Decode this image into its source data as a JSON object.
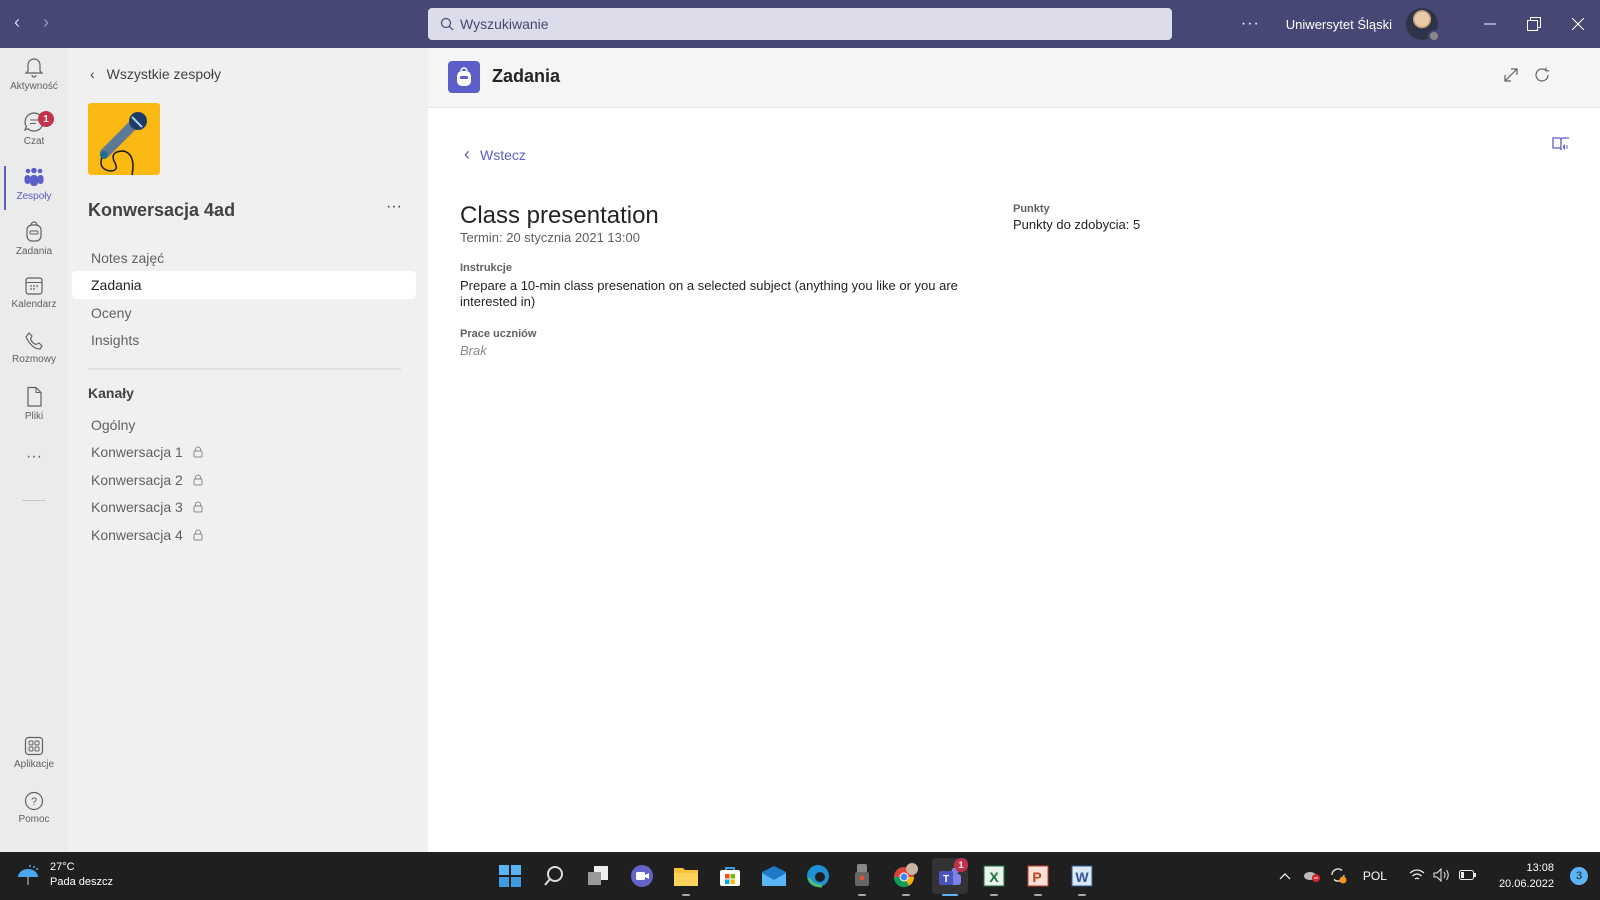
{
  "titlebar": {
    "search_placeholder": "Wyszukiwanie",
    "more_label": "···",
    "org_name": "Uniwersytet Śląski"
  },
  "rail": {
    "items": [
      {
        "label": "Aktywność",
        "icon": "bell-icon"
      },
      {
        "label": "Czat",
        "icon": "chat-icon",
        "badge": "1"
      },
      {
        "label": "Zespoły",
        "icon": "teams-icon",
        "active": true
      },
      {
        "label": "Zadania",
        "icon": "backpack-icon"
      },
      {
        "label": "Kalendarz",
        "icon": "calendar-icon"
      },
      {
        "label": "Rozmowy",
        "icon": "phone-icon"
      },
      {
        "label": "Pliki",
        "icon": "file-icon"
      }
    ],
    "more_label": "···",
    "apps_label": "Aplikacje",
    "help_label": "Pomoc"
  },
  "team": {
    "back_label": "Wszystkie zespoły",
    "name": "Konwersacja 4ad",
    "more_label": "···",
    "nav": [
      {
        "label": "Notes zajęć"
      },
      {
        "label": "Zadania",
        "active": true
      },
      {
        "label": "Oceny"
      },
      {
        "label": "Insights"
      }
    ],
    "channels_header": "Kanały",
    "channels": [
      {
        "label": "Ogólny",
        "private": false
      },
      {
        "label": "Konwersacja 1",
        "private": true
      },
      {
        "label": "Konwersacja 2",
        "private": true
      },
      {
        "label": "Konwersacja 3",
        "private": true
      },
      {
        "label": "Konwersacja 4",
        "private": true
      }
    ]
  },
  "app": {
    "title": "Zadania",
    "back_label": "Wstecz",
    "accent": "#5b5fc7"
  },
  "assignment": {
    "title": "Class presentation",
    "due": "Termin: 20 stycznia 2021 13:00",
    "instructions_label": "Instrukcje",
    "instructions": "Prepare a 10-min class presenation on a selected subject (anything you like or you are interested in)",
    "student_work_label": "Prace uczniów",
    "student_work_value": "Brak",
    "points_label": "Punkty",
    "points_value": "Punkty do zdobycia: 5"
  },
  "taskbar": {
    "temperature": "27°C",
    "weather": "Pada deszcz",
    "language": "POL",
    "time": "13:08",
    "date": "20.06.2022",
    "notifications": "3",
    "teams_badge": "1",
    "apps": [
      "start-icon",
      "search-icon",
      "task-view-icon",
      "meet-icon",
      "file-explorer-icon",
      "store-icon",
      "mail-icon",
      "edge-icon",
      "recorder-icon",
      "chrome-icon",
      "teams-icon",
      "excel-icon",
      "powerpoint-icon",
      "word-icon"
    ]
  }
}
